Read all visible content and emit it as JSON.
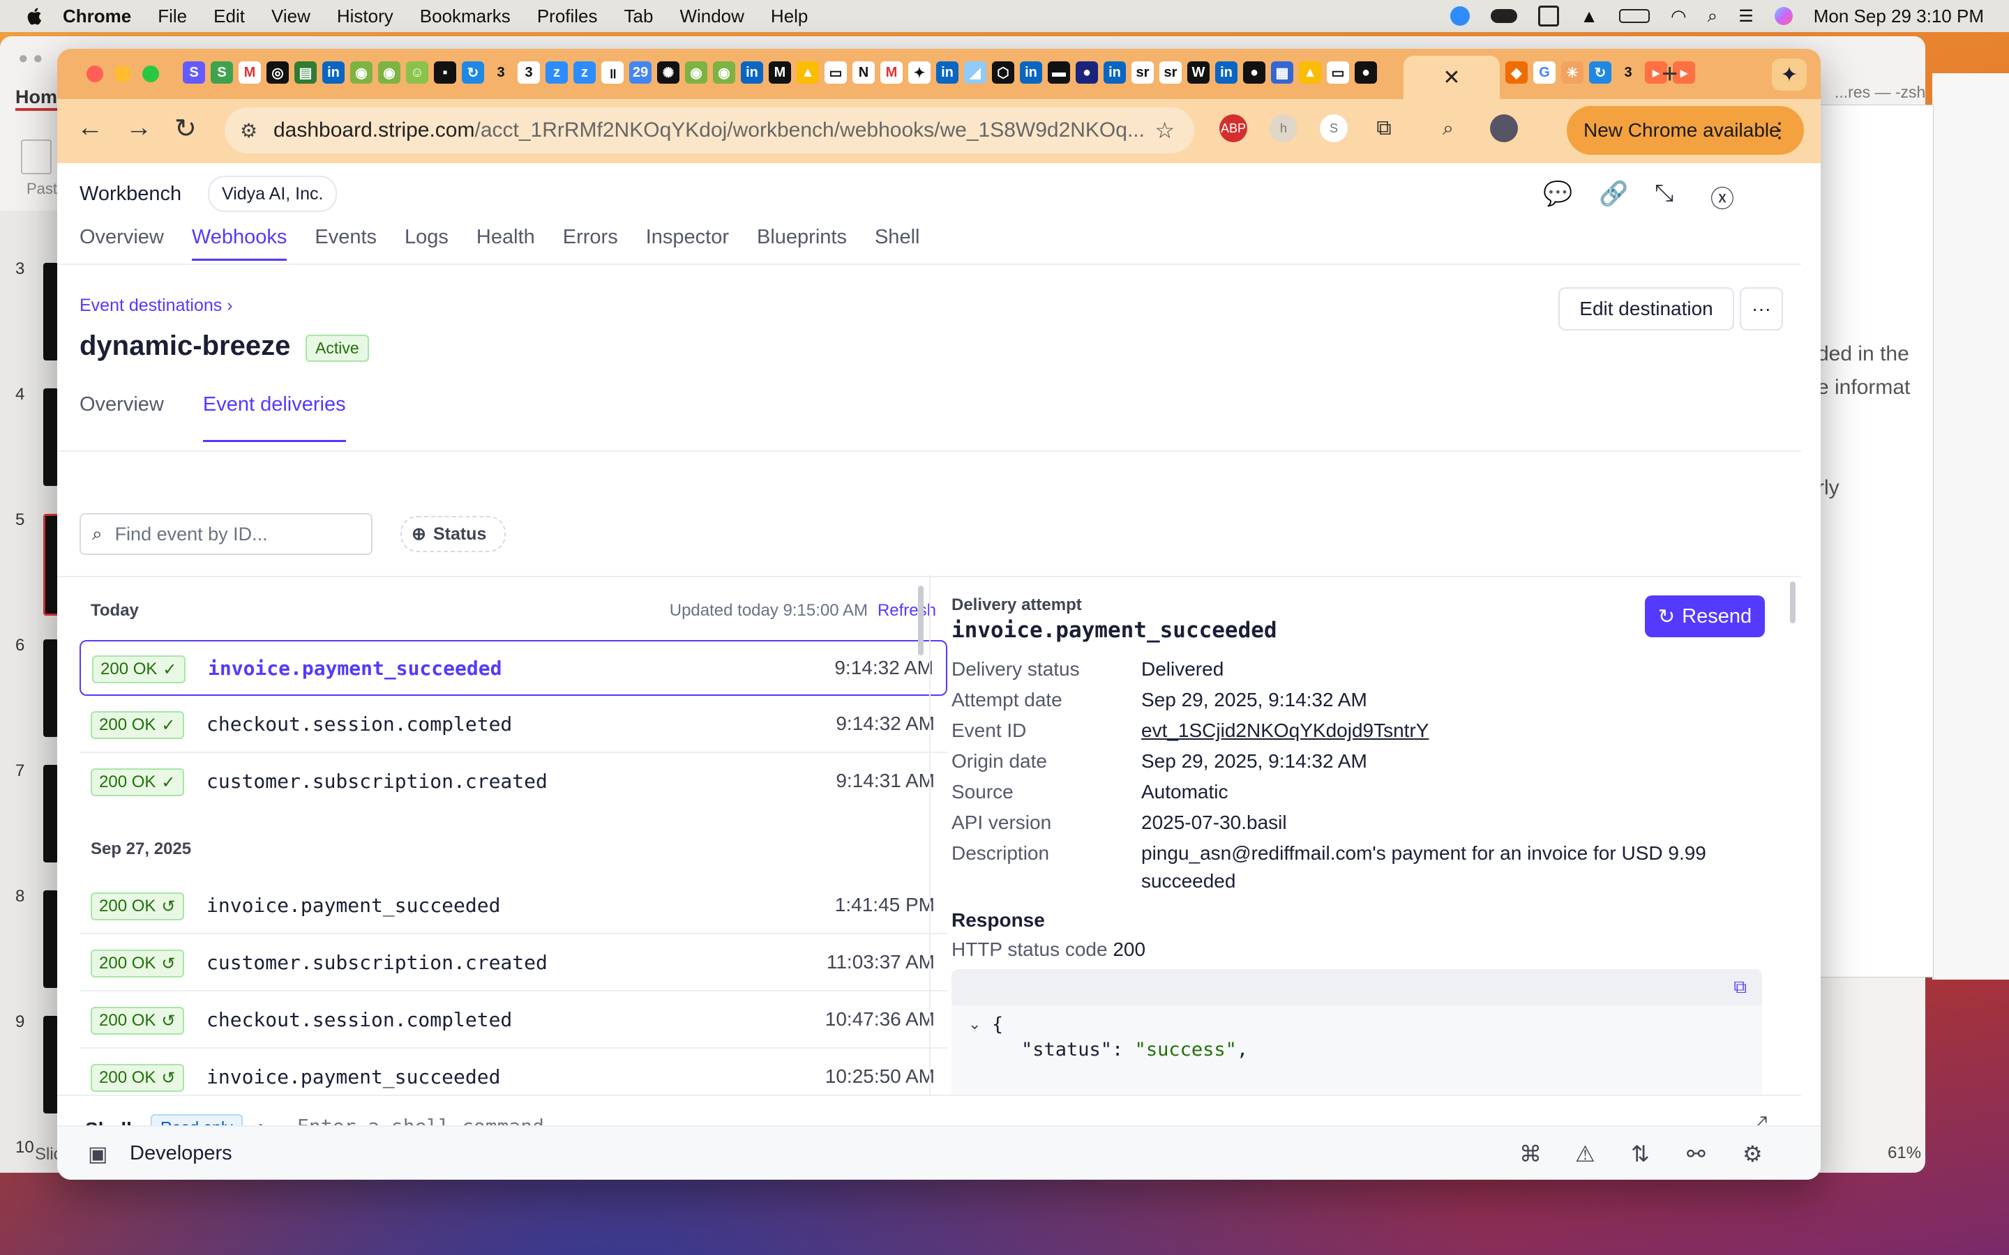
{
  "menubar": {
    "app": "Chrome",
    "items": [
      "File",
      "Edit",
      "View",
      "History",
      "Bookmarks",
      "Profiles",
      "Tab",
      "Window",
      "Help"
    ],
    "clock": "Mon Sep 29  3:10 PM"
  },
  "background": {
    "left_app_label": "Hom",
    "left_app_label2": "Past",
    "slide_numbers": [
      "3",
      "4",
      "5",
      "6",
      "7",
      "8",
      "9",
      "10"
    ],
    "slide_bottom": "Slic",
    "terminal_title": "...res — -zsh",
    "right_text": [
      "ded in the",
      "e informat",
      "rly"
    ],
    "zoom": "61%"
  },
  "chrome": {
    "tab_close": "✕",
    "new_tab": "+",
    "url_host": "dashboard.stripe.com",
    "url_path": "/acct_1RrRMf2NKOqYKdoj/workbench/webhooks/we_1S8W9d2NKOq...",
    "update_button": "New Chrome available"
  },
  "workbench": {
    "title": "Workbench",
    "account": "Vidya AI, Inc.",
    "tabs": [
      "Overview",
      "Webhooks",
      "Events",
      "Logs",
      "Health",
      "Errors",
      "Inspector",
      "Blueprints",
      "Shell"
    ],
    "active_tab": "Webhooks"
  },
  "destination": {
    "breadcrumb": "Event destinations",
    "name": "dynamic-breeze",
    "status": "Active",
    "edit_button": "Edit destination",
    "more_button": "···",
    "subtabs": [
      "Overview",
      "Event deliveries"
    ]
  },
  "filters": {
    "search_placeholder": "Find event by ID...",
    "status_label": "Status"
  },
  "deliveries": {
    "today_label": "Today",
    "updated_text": "Updated today 9:15:00 AM",
    "refresh": "Refresh",
    "older_label": "Sep 27, 2025",
    "today": [
      {
        "code": "200 OK",
        "event": "invoice.payment_succeeded",
        "time": "9:14:32 AM"
      },
      {
        "code": "200 OK",
        "event": "checkout.session.completed",
        "time": "9:14:32 AM"
      },
      {
        "code": "200 OK",
        "event": "customer.subscription.created",
        "time": "9:14:31 AM"
      }
    ],
    "older": [
      {
        "code": "200 OK",
        "event": "invoice.payment_succeeded",
        "time": "1:41:45 PM"
      },
      {
        "code": "200 OK",
        "event": "customer.subscription.created",
        "time": "11:03:37 AM"
      },
      {
        "code": "200 OK",
        "event": "checkout.session.completed",
        "time": "10:47:36 AM"
      },
      {
        "code": "200 OK",
        "event": "invoice.payment_succeeded",
        "time": "10:25:50 AM"
      }
    ]
  },
  "detail": {
    "heading": "Delivery attempt",
    "event": "invoice.payment_succeeded",
    "resend": "Resend",
    "fields": [
      {
        "k": "Delivery status",
        "v": "Delivered"
      },
      {
        "k": "Attempt date",
        "v": "Sep 29, 2025, 9:14:32 AM"
      },
      {
        "k": "Event ID",
        "v": "evt_1SCjid2NKOqYKdojd9TsntrY"
      },
      {
        "k": "Origin date",
        "v": "Sep 29, 2025, 9:14:32 AM"
      },
      {
        "k": "Source",
        "v": "Automatic"
      },
      {
        "k": "API version",
        "v": "2025-07-30.basil"
      },
      {
        "k": "Description",
        "v": "pingu_asn@rediffmail.com's payment for an invoice for USD 9.99"
      },
      {
        "k": "",
        "v": "succeeded"
      }
    ],
    "response_heading": "Response",
    "http_label": "HTTP status code",
    "http_code": "200",
    "code_line1": "{",
    "code_key": "\"status\": ",
    "code_val": "\"success\"",
    "code_comma": ","
  },
  "shell": {
    "label": "Shell",
    "badge": "Read only",
    "placeholder": "Enter a shell command..."
  },
  "devbar": {
    "label": "Developers"
  }
}
